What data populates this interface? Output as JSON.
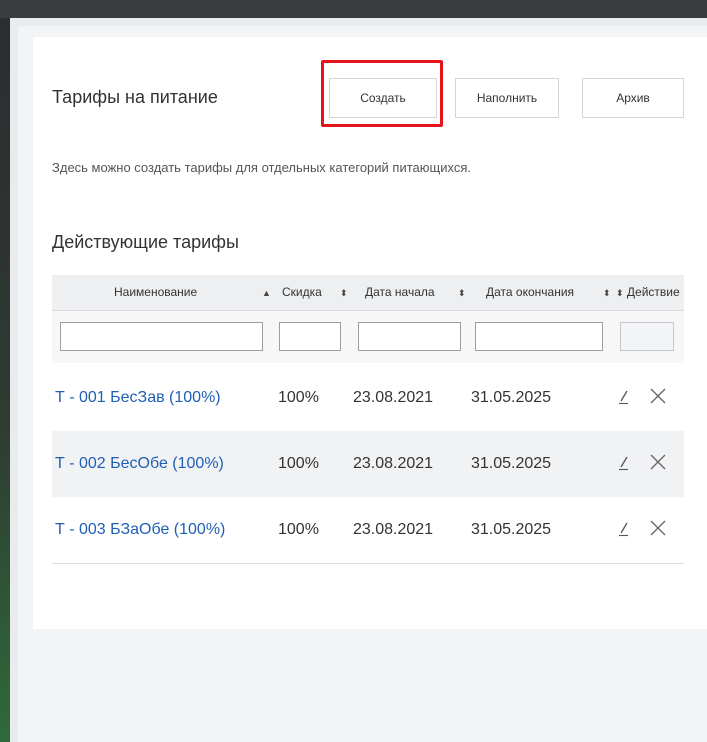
{
  "header": {
    "title": "Тарифы на питание",
    "buttons": {
      "create": "Создать",
      "fill": "Наполнить",
      "archive": "Архив"
    }
  },
  "description": "Здесь можно создать тарифы для отдельных категорий питающихся.",
  "section_title": "Действующие тарифы",
  "table": {
    "columns": [
      {
        "label": "Наименование",
        "sort_icon": "▲"
      },
      {
        "label": "Скидка",
        "sort_icon": "⬍"
      },
      {
        "label": "Дата начала",
        "sort_icon": "⬍"
      },
      {
        "label": "Дата окончания",
        "sort_icon": "⬍"
      },
      {
        "label": "Действие",
        "sort_icon": "⬍"
      }
    ],
    "rows": [
      {
        "name": "Т - 001 БесЗав (100%)",
        "discount": "100%",
        "start": "23.08.2021",
        "end": "31.05.2025"
      },
      {
        "name": "Т - 002 БесОбе (100%)",
        "discount": "100%",
        "start": "23.08.2021",
        "end": "31.05.2025"
      },
      {
        "name": "Т - 003 БЗаОбе (100%)",
        "discount": "100%",
        "start": "23.08.2021",
        "end": "31.05.2025"
      }
    ],
    "action_icons": [
      "edit-pencil-icon",
      "delete-x-icon"
    ]
  },
  "colors": {
    "link": "#1f5fb6",
    "highlight": "#e4141b",
    "header_bg": "#eeeff1",
    "alt_row": "#f1f2f4"
  }
}
